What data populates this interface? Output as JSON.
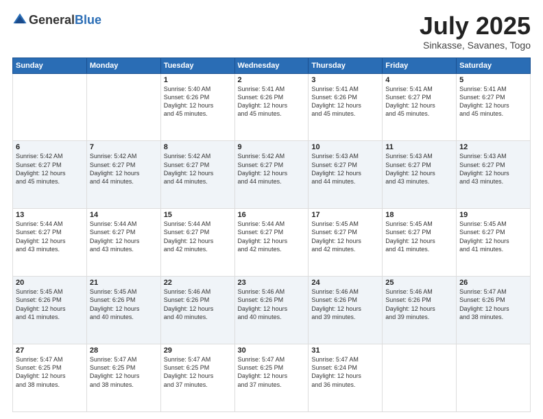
{
  "header": {
    "logo_general": "General",
    "logo_blue": "Blue",
    "month_title": "July 2025",
    "location": "Sinkasse, Savanes, Togo"
  },
  "weekdays": [
    "Sunday",
    "Monday",
    "Tuesday",
    "Wednesday",
    "Thursday",
    "Friday",
    "Saturday"
  ],
  "weeks": [
    [
      {
        "day": "",
        "info": ""
      },
      {
        "day": "",
        "info": ""
      },
      {
        "day": "1",
        "info": "Sunrise: 5:40 AM\nSunset: 6:26 PM\nDaylight: 12 hours\nand 45 minutes."
      },
      {
        "day": "2",
        "info": "Sunrise: 5:41 AM\nSunset: 6:26 PM\nDaylight: 12 hours\nand 45 minutes."
      },
      {
        "day": "3",
        "info": "Sunrise: 5:41 AM\nSunset: 6:26 PM\nDaylight: 12 hours\nand 45 minutes."
      },
      {
        "day": "4",
        "info": "Sunrise: 5:41 AM\nSunset: 6:27 PM\nDaylight: 12 hours\nand 45 minutes."
      },
      {
        "day": "5",
        "info": "Sunrise: 5:41 AM\nSunset: 6:27 PM\nDaylight: 12 hours\nand 45 minutes."
      }
    ],
    [
      {
        "day": "6",
        "info": "Sunrise: 5:42 AM\nSunset: 6:27 PM\nDaylight: 12 hours\nand 45 minutes."
      },
      {
        "day": "7",
        "info": "Sunrise: 5:42 AM\nSunset: 6:27 PM\nDaylight: 12 hours\nand 44 minutes."
      },
      {
        "day": "8",
        "info": "Sunrise: 5:42 AM\nSunset: 6:27 PM\nDaylight: 12 hours\nand 44 minutes."
      },
      {
        "day": "9",
        "info": "Sunrise: 5:42 AM\nSunset: 6:27 PM\nDaylight: 12 hours\nand 44 minutes."
      },
      {
        "day": "10",
        "info": "Sunrise: 5:43 AM\nSunset: 6:27 PM\nDaylight: 12 hours\nand 44 minutes."
      },
      {
        "day": "11",
        "info": "Sunrise: 5:43 AM\nSunset: 6:27 PM\nDaylight: 12 hours\nand 43 minutes."
      },
      {
        "day": "12",
        "info": "Sunrise: 5:43 AM\nSunset: 6:27 PM\nDaylight: 12 hours\nand 43 minutes."
      }
    ],
    [
      {
        "day": "13",
        "info": "Sunrise: 5:44 AM\nSunset: 6:27 PM\nDaylight: 12 hours\nand 43 minutes."
      },
      {
        "day": "14",
        "info": "Sunrise: 5:44 AM\nSunset: 6:27 PM\nDaylight: 12 hours\nand 43 minutes."
      },
      {
        "day": "15",
        "info": "Sunrise: 5:44 AM\nSunset: 6:27 PM\nDaylight: 12 hours\nand 42 minutes."
      },
      {
        "day": "16",
        "info": "Sunrise: 5:44 AM\nSunset: 6:27 PM\nDaylight: 12 hours\nand 42 minutes."
      },
      {
        "day": "17",
        "info": "Sunrise: 5:45 AM\nSunset: 6:27 PM\nDaylight: 12 hours\nand 42 minutes."
      },
      {
        "day": "18",
        "info": "Sunrise: 5:45 AM\nSunset: 6:27 PM\nDaylight: 12 hours\nand 41 minutes."
      },
      {
        "day": "19",
        "info": "Sunrise: 5:45 AM\nSunset: 6:27 PM\nDaylight: 12 hours\nand 41 minutes."
      }
    ],
    [
      {
        "day": "20",
        "info": "Sunrise: 5:45 AM\nSunset: 6:26 PM\nDaylight: 12 hours\nand 41 minutes."
      },
      {
        "day": "21",
        "info": "Sunrise: 5:45 AM\nSunset: 6:26 PM\nDaylight: 12 hours\nand 40 minutes."
      },
      {
        "day": "22",
        "info": "Sunrise: 5:46 AM\nSunset: 6:26 PM\nDaylight: 12 hours\nand 40 minutes."
      },
      {
        "day": "23",
        "info": "Sunrise: 5:46 AM\nSunset: 6:26 PM\nDaylight: 12 hours\nand 40 minutes."
      },
      {
        "day": "24",
        "info": "Sunrise: 5:46 AM\nSunset: 6:26 PM\nDaylight: 12 hours\nand 39 minutes."
      },
      {
        "day": "25",
        "info": "Sunrise: 5:46 AM\nSunset: 6:26 PM\nDaylight: 12 hours\nand 39 minutes."
      },
      {
        "day": "26",
        "info": "Sunrise: 5:47 AM\nSunset: 6:26 PM\nDaylight: 12 hours\nand 38 minutes."
      }
    ],
    [
      {
        "day": "27",
        "info": "Sunrise: 5:47 AM\nSunset: 6:25 PM\nDaylight: 12 hours\nand 38 minutes."
      },
      {
        "day": "28",
        "info": "Sunrise: 5:47 AM\nSunset: 6:25 PM\nDaylight: 12 hours\nand 38 minutes."
      },
      {
        "day": "29",
        "info": "Sunrise: 5:47 AM\nSunset: 6:25 PM\nDaylight: 12 hours\nand 37 minutes."
      },
      {
        "day": "30",
        "info": "Sunrise: 5:47 AM\nSunset: 6:25 PM\nDaylight: 12 hours\nand 37 minutes."
      },
      {
        "day": "31",
        "info": "Sunrise: 5:47 AM\nSunset: 6:24 PM\nDaylight: 12 hours\nand 36 minutes."
      },
      {
        "day": "",
        "info": ""
      },
      {
        "day": "",
        "info": ""
      }
    ]
  ]
}
